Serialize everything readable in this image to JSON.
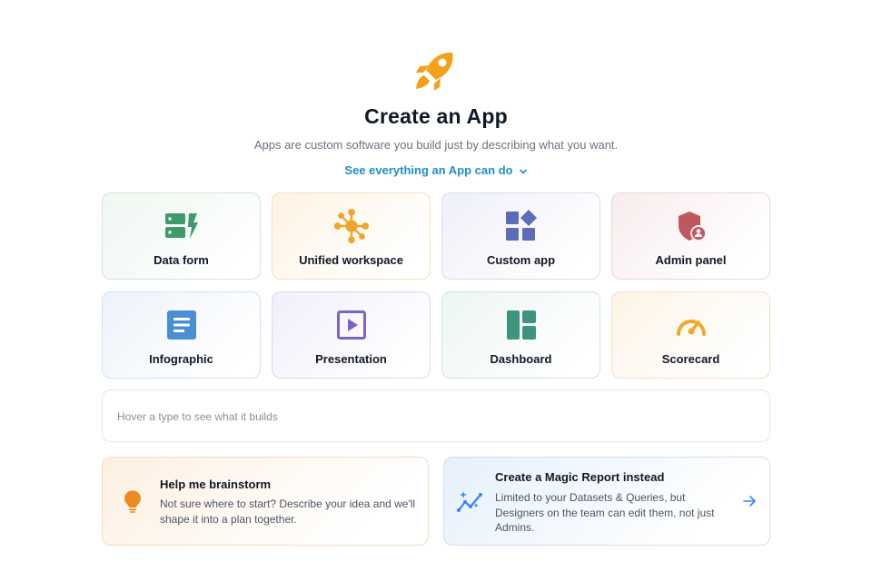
{
  "hero": {
    "icon": "rocket-icon",
    "title": "Create an App",
    "subtitle": "Apps are custom software you build just by describing what you want.",
    "see_all_label": "See everything an App can do"
  },
  "app_types": [
    {
      "label": "Data form",
      "icon": "data-form-icon",
      "color": "#3f9a6a"
    },
    {
      "label": "Unified workspace",
      "icon": "network-hub-icon",
      "color": "#f0a52a"
    },
    {
      "label": "Custom app",
      "icon": "app-blocks-icon",
      "color": "#5b6cb8"
    },
    {
      "label": "Admin panel",
      "icon": "shield-user-icon",
      "color": "#c0565e"
    },
    {
      "label": "Infographic",
      "icon": "document-icon",
      "color": "#4a8fd1"
    },
    {
      "label": "Presentation",
      "icon": "play-slide-icon",
      "color": "#7b64c4"
    },
    {
      "label": "Dashboard",
      "icon": "dashboard-layout-icon",
      "color": "#3d9580"
    },
    {
      "label": "Scorecard",
      "icon": "gauge-icon",
      "color": "#efaa2c"
    }
  ],
  "hover_hint": "Hover a type to see what it builds",
  "brainstorm": {
    "icon": "lightbulb-icon",
    "title": "Help me brainstorm",
    "description": "Not sure where to start? Describe your idea and we'll shape it into a plan together."
  },
  "magic_report": {
    "icon": "sparkle-chart-icon",
    "title": "Create a Magic Report instead",
    "description": "Limited to your Datasets & Queries, but Designers on the team can edit them, not just Admins.",
    "arrow_icon": "arrow-right-icon"
  },
  "colors": {
    "accent_link": "#1f8fc7",
    "rocket": "#f5a01a",
    "brainstorm_icon": "#ec8a1f",
    "magic_icon": "#3b82f6"
  }
}
